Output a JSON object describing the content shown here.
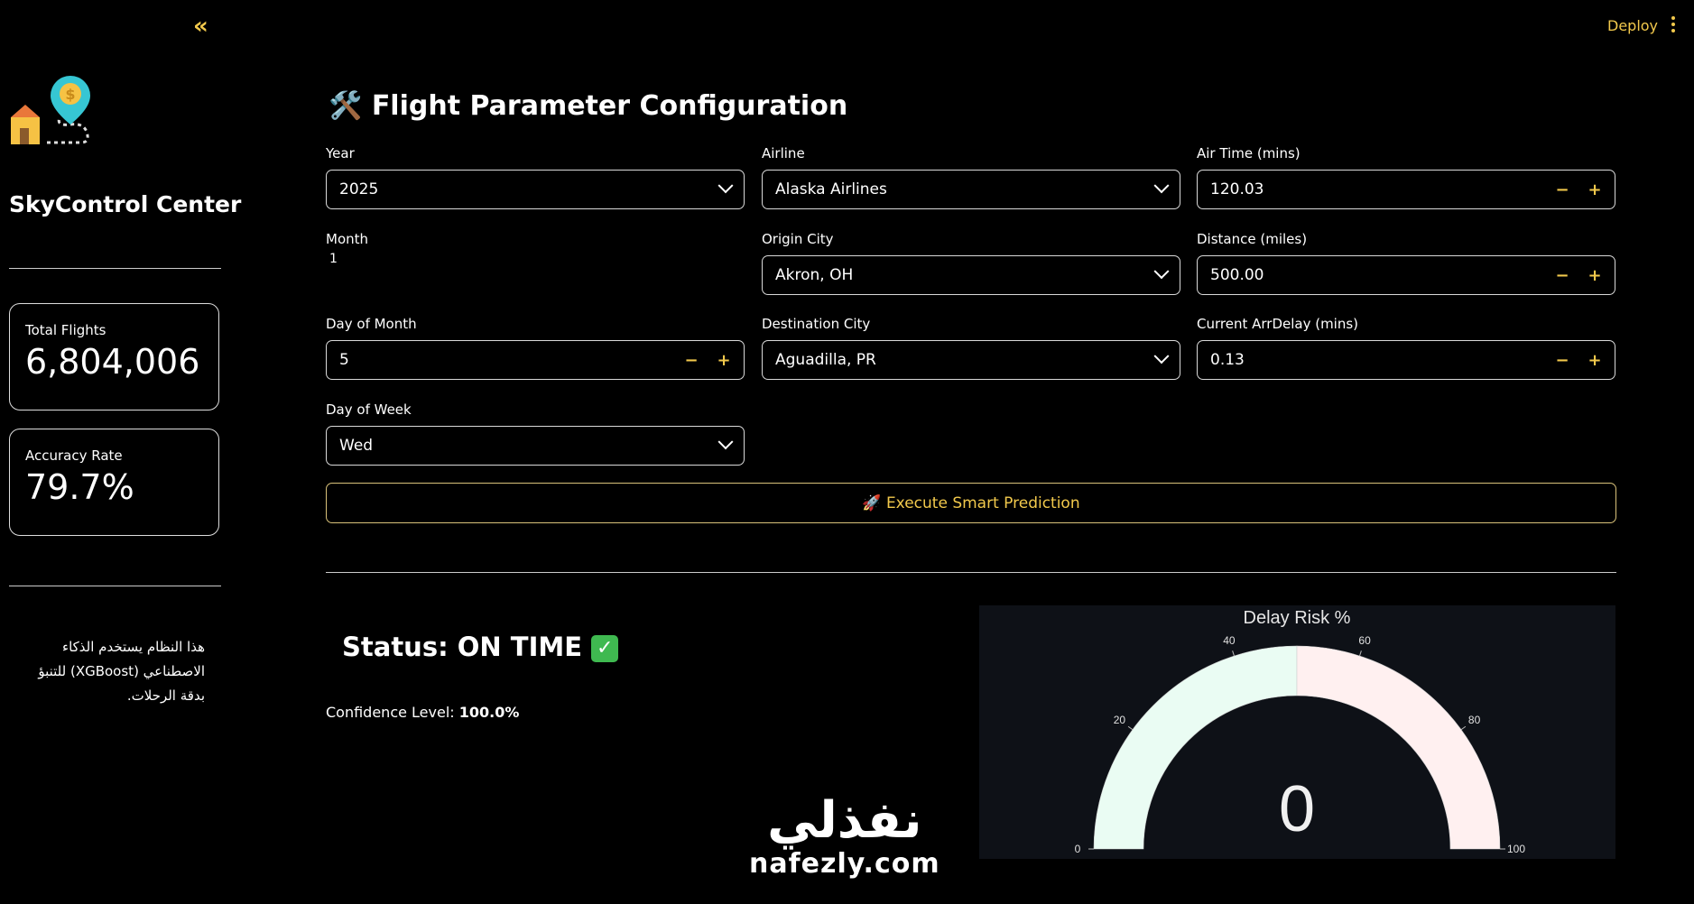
{
  "topbar": {
    "collapse_icon": "double-chevron-left-icon",
    "deploy_label": "Deploy",
    "menu_icon": "kebab-icon"
  },
  "sidebar": {
    "app_name": "SkyControl Center",
    "metrics": [
      {
        "label": "Total Flights",
        "value": "6,804,006"
      },
      {
        "label": "Accuracy Rate",
        "value": "79.7%"
      }
    ],
    "note": "هذا النظام يستخدم الذكاء الاصطناعي (XGBoost) للتنبؤ بدقة الرحلات."
  },
  "main": {
    "title_icon": "🛠️",
    "title": "Flight Parameter Configuration",
    "fields": {
      "year": {
        "label": "Year",
        "value": "2025"
      },
      "month": {
        "label": "Month",
        "value": "1"
      },
      "day_of_month": {
        "label": "Day of Month",
        "value": "5"
      },
      "day_of_week": {
        "label": "Day of Week",
        "value": "Wed"
      },
      "airline": {
        "label": "Airline",
        "value": "Alaska Airlines"
      },
      "origin": {
        "label": "Origin City",
        "value": "Akron, OH"
      },
      "destination": {
        "label": "Destination City",
        "value": "Aguadilla, PR"
      },
      "air_time": {
        "label": "Air Time (mins)",
        "value": "120.03"
      },
      "distance": {
        "label": "Distance (miles)",
        "value": "500.00"
      },
      "arr_delay": {
        "label": "Current ArrDelay (mins)",
        "value": "0.13"
      }
    },
    "stepper": {
      "minus": "−",
      "plus": "+"
    },
    "execute_label": "🚀 Execute Smart Prediction",
    "status_label": "Status: ON TIME",
    "status_icon": "✓",
    "confidence_label": "Confidence Level: ",
    "confidence_value": "100.0%"
  },
  "chart_data": {
    "type": "gauge",
    "title": "Delay Risk %",
    "value": 0,
    "range": [
      0,
      100
    ],
    "ticks": [
      "0",
      "20",
      "40",
      "60",
      "80",
      "100"
    ],
    "bands": [
      {
        "range": [
          0,
          50
        ],
        "color": "#eafcf3"
      },
      {
        "range": [
          50,
          100
        ],
        "color": "#fff0f0"
      }
    ]
  },
  "watermark": {
    "arabic": "نفذلي",
    "latin": "nafezly.com"
  }
}
